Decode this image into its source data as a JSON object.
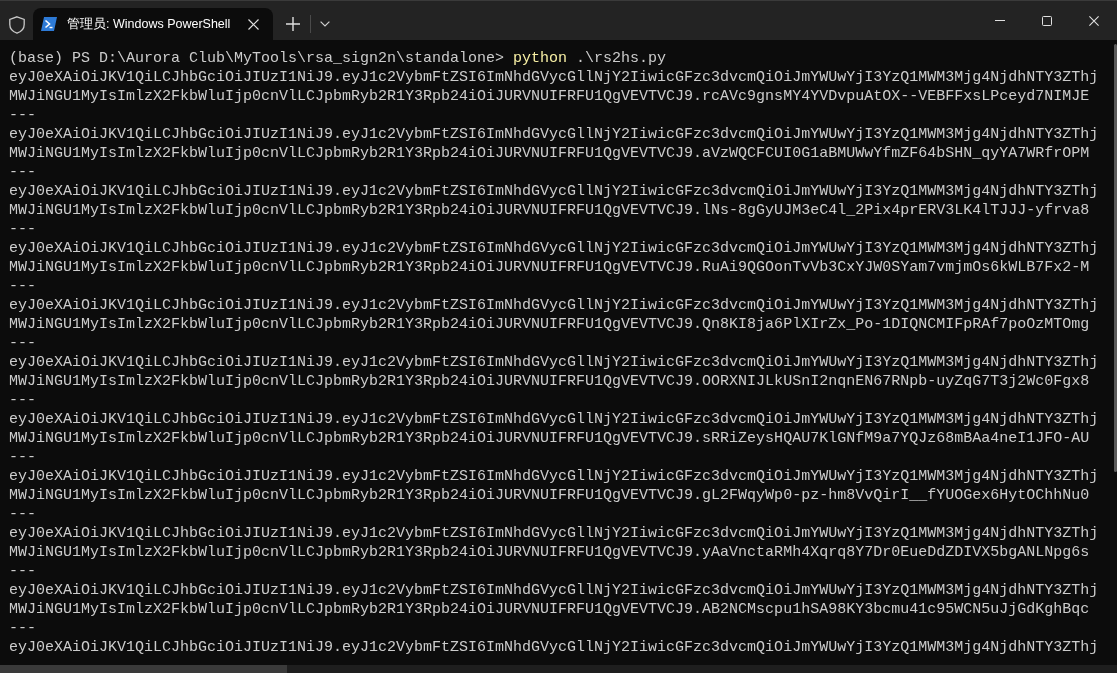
{
  "tabs": [
    {
      "title": "管理员: Windows PowerShell",
      "selected": true
    }
  ],
  "terminal": {
    "prompt": "(base) PS D:\\Aurora Club\\MyTools\\rsa_sign2n\\standalone>",
    "command": "python",
    "argument": ".\\rs2hs.py",
    "output": [
      "eyJ0eXAiOiJKV1QiLCJhbGciOiJIUzI1NiJ9.eyJ1c2VybmFtZSI6ImNhdGVycGllNjY2IiwicGFzc3dvcmQiOiJmYWUwYjI3YzQ1MWM3Mjg4NjdhNTY3ZThj",
      "MWJiNGU1MyIsImlzX2FkbWluIjp0cnVlLCJpbmRyb2R1Y3Rpb24iOiJURVNUIFRFU1QgVEVTVCJ9.rcAVc9gnsMY4YVDvpuAtOX--VEBFFxsLPceyd7NIMJE",
      "---",
      "eyJ0eXAiOiJKV1QiLCJhbGciOiJIUzI1NiJ9.eyJ1c2VybmFtZSI6ImNhdGVycGllNjY2IiwicGFzc3dvcmQiOiJmYWUwYjI3YzQ1MWM3Mjg4NjdhNTY3ZThj",
      "MWJiNGU1MyIsImlzX2FkbWluIjp0cnVlLCJpbmRyb2R1Y3Rpb24iOiJURVNUIFRFU1QgVEVTVCJ9.aVzWQCFCUI0G1aBMUWwYfmZF64bSHN_qyYA7WRfrOPM",
      "---",
      "eyJ0eXAiOiJKV1QiLCJhbGciOiJIUzI1NiJ9.eyJ1c2VybmFtZSI6ImNhdGVycGllNjY2IiwicGFzc3dvcmQiOiJmYWUwYjI3YzQ1MWM3Mjg4NjdhNTY3ZThj",
      "MWJiNGU1MyIsImlzX2FkbWluIjp0cnVlLCJpbmRyb2R1Y3Rpb24iOiJURVNUIFRFU1QgVEVTVCJ9.lNs-8gGyUJM3eC4l_2Pix4prERV3LK4lTJJJ-yfrva8",
      "---",
      "eyJ0eXAiOiJKV1QiLCJhbGciOiJIUzI1NiJ9.eyJ1c2VybmFtZSI6ImNhdGVycGllNjY2IiwicGFzc3dvcmQiOiJmYWUwYjI3YzQ1MWM3Mjg4NjdhNTY3ZThj",
      "MWJiNGU1MyIsImlzX2FkbWluIjp0cnVlLCJpbmRyb2R1Y3Rpb24iOiJURVNUIFRFU1QgVEVTVCJ9.RuAi9QGOonTvVb3CxYJW0SYam7vmjmOs6kWLB7Fx2-M",
      "---",
      "eyJ0eXAiOiJKV1QiLCJhbGciOiJIUzI1NiJ9.eyJ1c2VybmFtZSI6ImNhdGVycGllNjY2IiwicGFzc3dvcmQiOiJmYWUwYjI3YzQ1MWM3Mjg4NjdhNTY3ZThj",
      "MWJiNGU1MyIsImlzX2FkbWluIjp0cnVlLCJpbmRyb2R1Y3Rpb24iOiJURVNUIFRFU1QgVEVTVCJ9.Qn8KI8ja6PlXIrZx_Po-1DIQNCMIFpRAf7poOzMTOmg",
      "---",
      "eyJ0eXAiOiJKV1QiLCJhbGciOiJIUzI1NiJ9.eyJ1c2VybmFtZSI6ImNhdGVycGllNjY2IiwicGFzc3dvcmQiOiJmYWUwYjI3YzQ1MWM3Mjg4NjdhNTY3ZThj",
      "MWJiNGU1MyIsImlzX2FkbWluIjp0cnVlLCJpbmRyb2R1Y3Rpb24iOiJURVNUIFRFU1QgVEVTVCJ9.OORXNIJLkUSnI2nqnEN67RNpb-uyZqG7T3j2Wc0Fgx8",
      "---",
      "eyJ0eXAiOiJKV1QiLCJhbGciOiJIUzI1NiJ9.eyJ1c2VybmFtZSI6ImNhdGVycGllNjY2IiwicGFzc3dvcmQiOiJmYWUwYjI3YzQ1MWM3Mjg4NjdhNTY3ZThj",
      "MWJiNGU1MyIsImlzX2FkbWluIjp0cnVlLCJpbmRyb2R1Y3Rpb24iOiJURVNUIFRFU1QgVEVTVCJ9.sRRiZeysHQAU7KlGNfM9a7YQJz68mBAa4neI1JFO-AU",
      "---",
      "eyJ0eXAiOiJKV1QiLCJhbGciOiJIUzI1NiJ9.eyJ1c2VybmFtZSI6ImNhdGVycGllNjY2IiwicGFzc3dvcmQiOiJmYWUwYjI3YzQ1MWM3Mjg4NjdhNTY3ZThj",
      "MWJiNGU1MyIsImlzX2FkbWluIjp0cnVlLCJpbmRyb2R1Y3Rpb24iOiJURVNUIFRFU1QgVEVTVCJ9.gL2FWqyWp0-pz-hm8VvQirI__fYUOGex6HytOChhNu0",
      "---",
      "eyJ0eXAiOiJKV1QiLCJhbGciOiJIUzI1NiJ9.eyJ1c2VybmFtZSI6ImNhdGVycGllNjY2IiwicGFzc3dvcmQiOiJmYWUwYjI3YzQ1MWM3Mjg4NjdhNTY3ZThj",
      "MWJiNGU1MyIsImlzX2FkbWluIjp0cnVlLCJpbmRyb2R1Y3Rpb24iOiJURVNUIFRFU1QgVEVTVCJ9.yAaVnctaRMh4Xqrq8Y7Dr0EueDdZDIVX5bgANLNpg6s",
      "---",
      "eyJ0eXAiOiJKV1QiLCJhbGciOiJIUzI1NiJ9.eyJ1c2VybmFtZSI6ImNhdGVycGllNjY2IiwicGFzc3dvcmQiOiJmYWUwYjI3YzQ1MWM3Mjg4NjdhNTY3ZThj",
      "MWJiNGU1MyIsImlzX2FkbWluIjp0cnVlLCJpbmRyb2R1Y3Rpb24iOiJURVNUIFRFU1QgVEVTVCJ9.AB2NCMscpu1hSA98KY3bcmu41c95WCN5uJjGdKghBqc",
      "---",
      "eyJ0eXAiOiJKV1QiLCJhbGciOiJIUzI1NiJ9.eyJ1c2VybmFtZSI6ImNhdGVycGllNjY2IiwicGFzc3dvcmQiOiJmYWUwYjI3YzQ1MWM3Mjg4NjdhNTY3ZThj"
    ]
  }
}
